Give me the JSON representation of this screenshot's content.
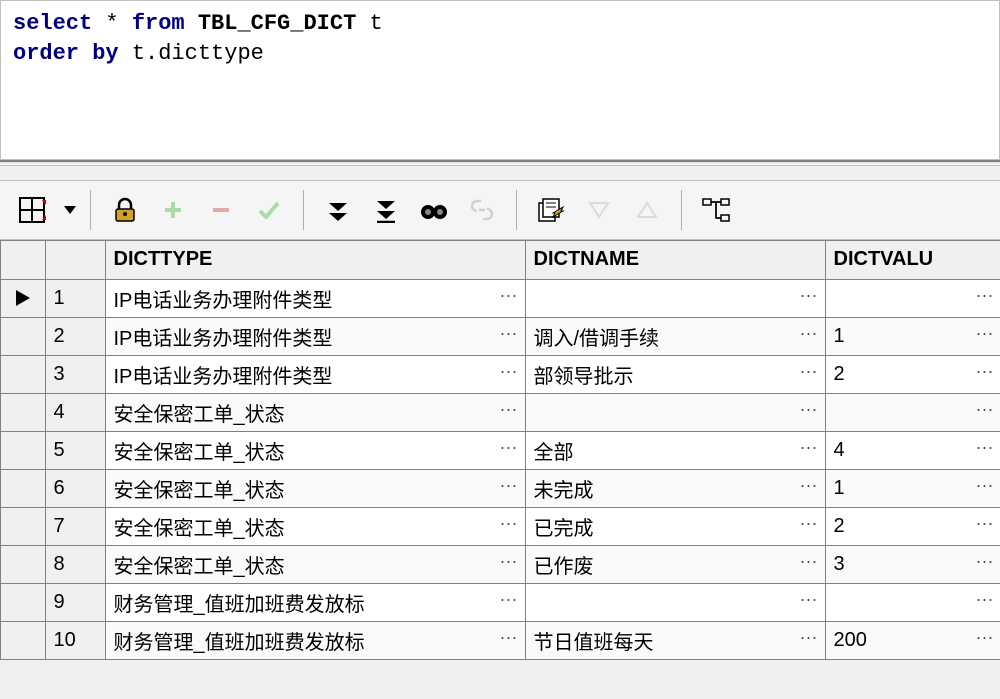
{
  "sql": {
    "line1_kw1": "select",
    "line1_star": " * ",
    "line1_kw2": "from",
    "line1_tbl": " TBL_CFG_DICT ",
    "line1_alias": "t",
    "line2_kw1": "order by",
    "line2_expr": " t.dicttype"
  },
  "columns": {
    "dicttype": "DICTTYPE",
    "dictname": "DICTNAME",
    "dictvalue": "DICTVALU"
  },
  "rows": [
    {
      "n": "1",
      "dicttype": "IP电话业务办理附件类型",
      "dictname": "",
      "dictvalue": ""
    },
    {
      "n": "2",
      "dicttype": "IP电话业务办理附件类型",
      "dictname": "调入/借调手续",
      "dictvalue": "1"
    },
    {
      "n": "3",
      "dicttype": "IP电话业务办理附件类型",
      "dictname": "部领导批示",
      "dictvalue": "2"
    },
    {
      "n": "4",
      "dicttype": "安全保密工单_状态",
      "dictname": "",
      "dictvalue": ""
    },
    {
      "n": "5",
      "dicttype": "安全保密工单_状态",
      "dictname": "全部",
      "dictvalue": "4"
    },
    {
      "n": "6",
      "dicttype": "安全保密工单_状态",
      "dictname": "未完成",
      "dictvalue": "1"
    },
    {
      "n": "7",
      "dicttype": "安全保密工单_状态",
      "dictname": "已完成",
      "dictvalue": "2"
    },
    {
      "n": "8",
      "dicttype": "安全保密工单_状态",
      "dictname": "已作废",
      "dictvalue": "3"
    },
    {
      "n": "9",
      "dicttype": "财务管理_值班加班费发放标",
      "dictname": "",
      "dictvalue": ""
    },
    {
      "n": "10",
      "dicttype": "财务管理_值班加班费发放标",
      "dictname": "节日值班每天",
      "dictvalue": "200"
    }
  ],
  "ellipsis": "···"
}
